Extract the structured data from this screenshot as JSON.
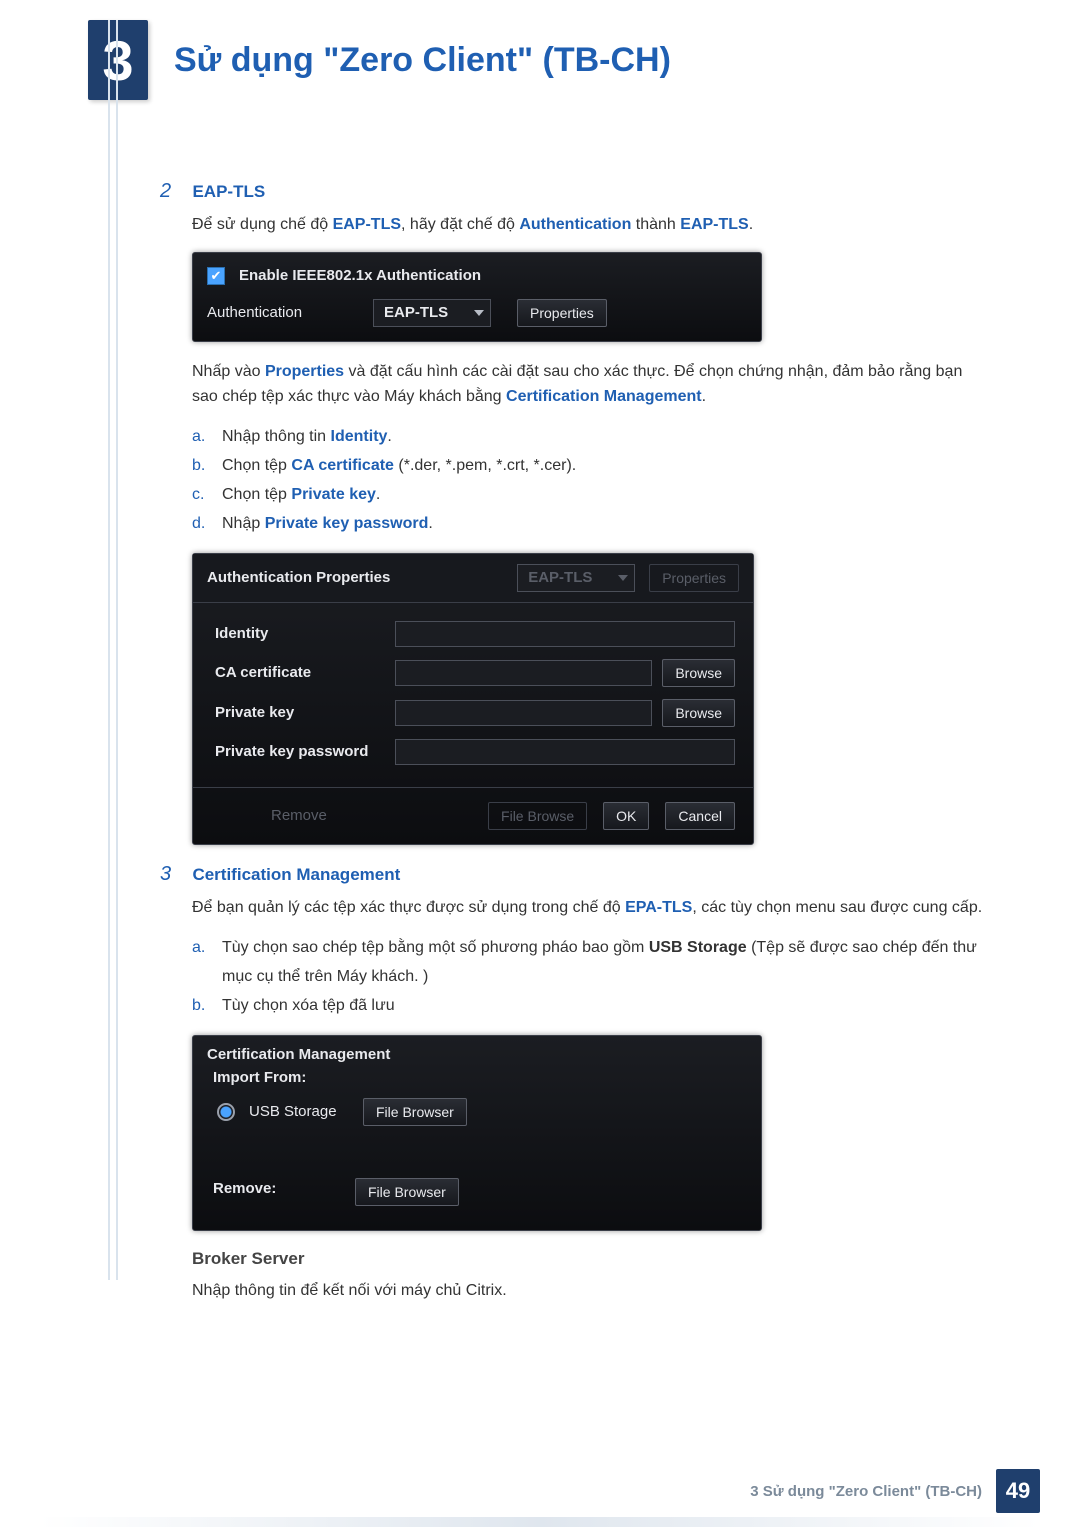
{
  "header": {
    "chapter_number": "3",
    "chapter_title": "Sử dụng \"Zero Client\" (TB-CH)"
  },
  "section2": {
    "num": "2",
    "title": "EAP-TLS",
    "intro_pre": "Để sử dụng chế độ ",
    "intro_b1": "EAP-TLS",
    "intro_mid": ", hãy đặt chế độ ",
    "intro_b2": "Authentication",
    "intro_mid2": " thành ",
    "intro_b3": "EAP-TLS",
    "intro_end": ".",
    "panel1": {
      "enable_label": "Enable IEEE802.1x Authentication",
      "auth_label": "Authentication",
      "auth_value": "EAP-TLS",
      "properties_btn": "Properties"
    },
    "para2_pre": "Nhấp vào ",
    "para2_b1": "Properties",
    "para2_mid": " và đặt cấu hình các cài đặt sau cho xác thực. Để chọn chứng nhận, đảm bảo rằng bạn sao chép tệp xác thực vào Máy khách bằng ",
    "para2_b2": "Certification Management",
    "para2_end": ".",
    "steps": {
      "a": {
        "pre": "Nhập thông tin ",
        "b": "Identity",
        "post": "."
      },
      "b": {
        "pre": "Chọn tệp ",
        "b": "CA certificate",
        "post": " (*.der, *.pem, *.crt, *.cer)."
      },
      "c": {
        "pre": "Chọn tệp ",
        "b": "Private key",
        "post": "."
      },
      "d": {
        "pre": "Nhập ",
        "b": "Private key password",
        "post": "."
      }
    },
    "panel2": {
      "title": "Authentication Properties",
      "ghost_dropdown": "EAP-TLS",
      "ghost_properties": "Properties",
      "identity_label": "Identity",
      "ca_label": "CA certificate",
      "pk_label": "Private key",
      "pkpw_label": "Private key password",
      "browse_btn": "Browse",
      "remove_ghost": "Remove",
      "filebrowse_ghost": "File Browse",
      "ok_btn": "OK",
      "cancel_btn": "Cancel"
    }
  },
  "section3": {
    "num": "3",
    "title": "Certification Management",
    "para_pre": "Để bạn quản lý các tệp xác thực được sử dụng trong chế độ ",
    "para_b": "EPA-TLS",
    "para_post": ", các tùy chọn menu sau được cung cấp.",
    "steps": {
      "a": {
        "pre": "Tùy chọn sao chép tệp bằng một số phương pháo bao gồm ",
        "b": "USB Storage",
        "post": " (Tệp sẽ được sao chép đến thư mục cụ thể trên Máy khách. )"
      },
      "b": {
        "text": "Tùy chọn xóa tệp đã lưu"
      }
    },
    "panel3": {
      "title": "Certification Management",
      "import_label": "Import From:",
      "usb_label": "USB Storage",
      "file_browser_btn": "File Browser",
      "remove_label": "Remove:"
    }
  },
  "broker": {
    "title": "Broker Server",
    "text": "Nhập thông tin để kết nối với máy chủ Citrix."
  },
  "footer": {
    "text": "3 Sử dụng \"Zero Client\" (TB-CH)",
    "page": "49"
  }
}
